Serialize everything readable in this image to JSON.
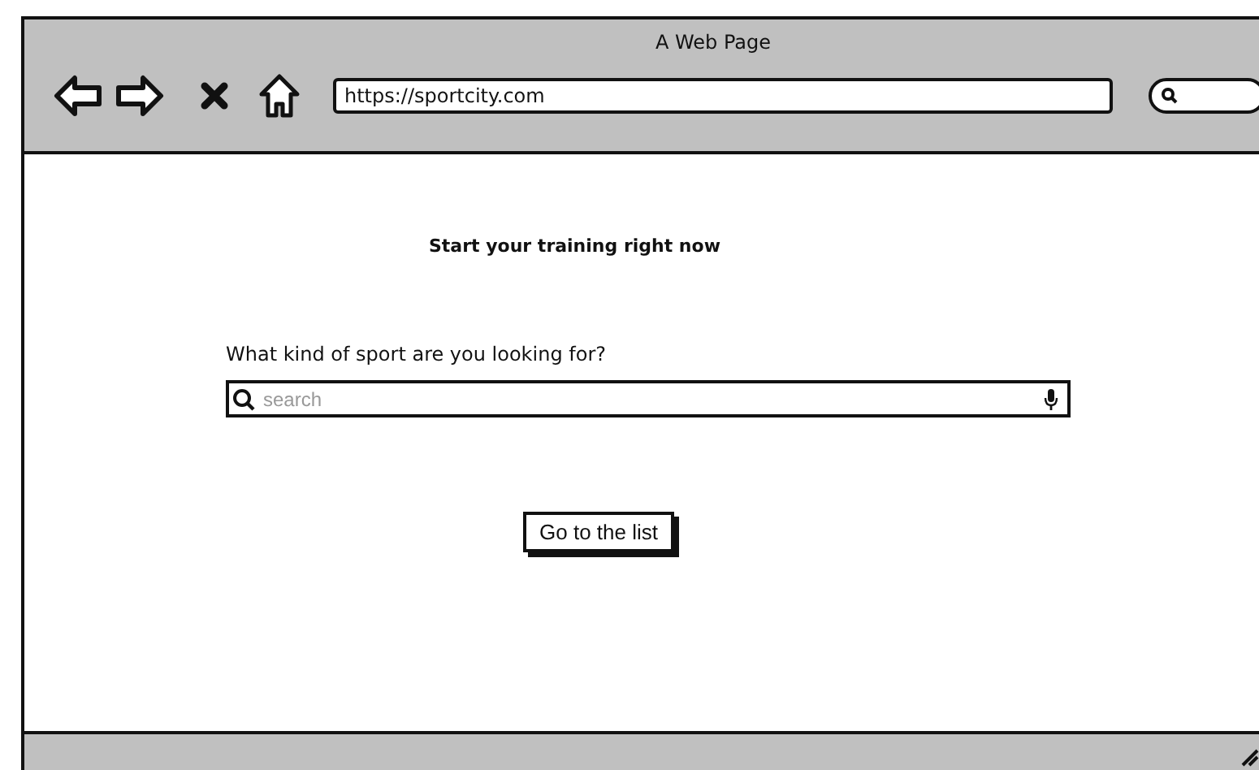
{
  "window": {
    "title": "A Web Page"
  },
  "toolbar": {
    "url": "https://sportcity.com"
  },
  "page": {
    "heading": "Start your training right now",
    "question": "What kind of sport are you looking for?",
    "search": {
      "placeholder": "search"
    },
    "button": "Go to the list"
  }
}
